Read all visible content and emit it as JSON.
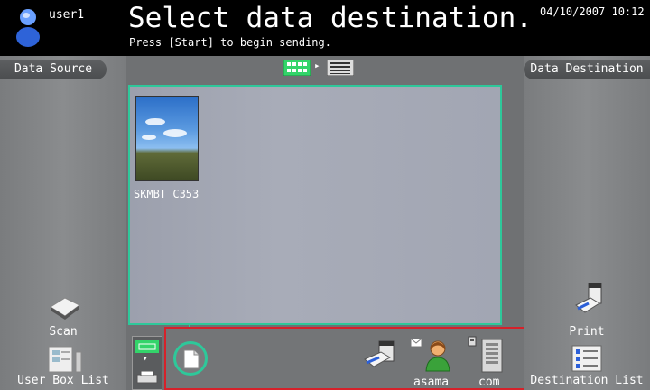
{
  "header": {
    "user": "user1",
    "title": "Select data destination.",
    "subtitle": "Press [Start] to begin sending.",
    "datetime": "04/10/2007  10:12"
  },
  "left_panel": {
    "header": "Data Source",
    "scan_label": "Scan",
    "user_box_label": "User Box List"
  },
  "right_panel": {
    "header": "Data Destination",
    "print_label": "Print",
    "dest_list_label": "Destination List"
  },
  "file": {
    "name": "SKMBT_C353"
  },
  "destinations": [
    {
      "label": "asama",
      "icon": "user-mail-icon"
    },
    {
      "label": "com",
      "icon": "server-icon"
    }
  ],
  "colors": {
    "accent_green": "#2ec89a",
    "highlight_red": "#d6212a",
    "header_bg": "#000000"
  }
}
